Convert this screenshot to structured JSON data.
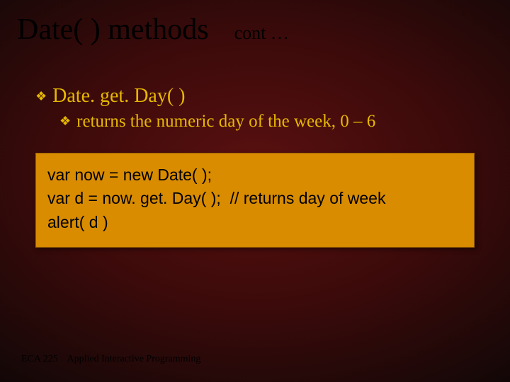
{
  "title": "Date( ) methods",
  "cont": "cont …",
  "bullet1": "Date. get. Day(  )",
  "bullet2": "returns  the numeric day of the week,  0 – 6",
  "code": {
    "line1": "var now = new Date( );",
    "line2": "var d = now. get. Day( );  // returns day of week",
    "line3": "alert( d )"
  },
  "footer": {
    "course": "ECA 225",
    "name": "Applied Interactive Programming"
  }
}
